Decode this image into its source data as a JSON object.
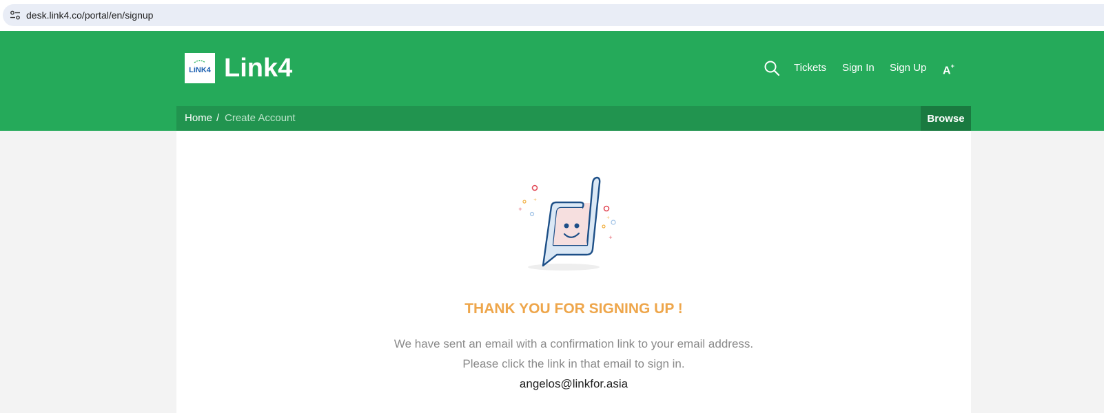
{
  "browser": {
    "url": "desk.link4.co/portal/en/signup",
    "site_info_icon": "tune-icon"
  },
  "header": {
    "logo_text": "LiNK4",
    "brand_name": "Link4",
    "nav": {
      "search_icon": "search-icon",
      "tickets": "Tickets",
      "sign_in": "Sign In",
      "sign_up": "Sign Up",
      "font_size_icon": "A"
    }
  },
  "breadcrumb": {
    "home": "Home",
    "separator": "/",
    "current": "Create Account",
    "browse_label": "Browse"
  },
  "main": {
    "illustration_icon": "smiling-chat-bubble-illustration",
    "title": "THANK YOU FOR SIGNING UP !",
    "message_line1": "We have sent an email with a confirmation link to your email address.",
    "message_line2": "Please click the link in that email to sign in.",
    "email": "angelos@linkfor.asia"
  },
  "colors": {
    "header_green": "#25aa5a",
    "breadcrumb_green": "#21944f",
    "browse_green": "#1a7a40",
    "title_orange": "#eea64b"
  }
}
